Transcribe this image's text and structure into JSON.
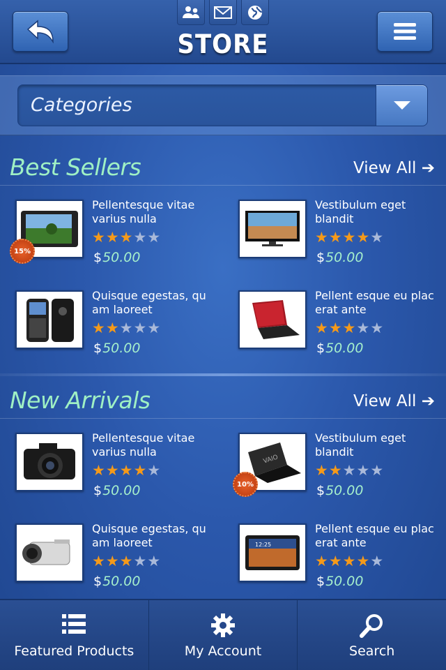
{
  "header": {
    "title": "STORE",
    "top_icons": [
      "users-icon",
      "mail-icon",
      "globe-icon"
    ],
    "back_icon": "back-arrow-icon",
    "menu_icon": "hamburger-menu-icon"
  },
  "categories": {
    "label": "Categories",
    "arrow_icon": "chevron-down-icon"
  },
  "sections": [
    {
      "title": "Best Sellers",
      "view_all": "View All ➔",
      "products": [
        {
          "name": "Pellentesque vitae varius nulla",
          "rating": 3,
          "currency": "$",
          "price": "50.00",
          "badge": "15%",
          "image": "tablet"
        },
        {
          "name": "Vestibulum eget blandit",
          "rating": 4,
          "currency": "$",
          "price": "50.00",
          "badge": "",
          "image": "monitor"
        },
        {
          "name": "Quisque egestas, qu am laoreet",
          "rating": 2,
          "currency": "$",
          "price": "50.00",
          "badge": "",
          "image": "phone"
        },
        {
          "name": "Pellent esque eu plac erat ante",
          "rating": 3,
          "currency": "$",
          "price": "50.00",
          "badge": "",
          "image": "laptop-red"
        }
      ]
    },
    {
      "title": "New Arrivals",
      "view_all": "View All ➔",
      "products": [
        {
          "name": "Pellentesque vitae varius nulla",
          "rating": 4,
          "currency": "$",
          "price": "50.00",
          "badge": "",
          "image": "camera"
        },
        {
          "name": "Vestibulum eget blandit",
          "rating": 2,
          "currency": "$",
          "price": "50.00",
          "badge": "10%",
          "image": "laptop-black"
        },
        {
          "name": "Quisque egestas, qu am laoreet",
          "rating": 3,
          "currency": "$",
          "price": "50.00",
          "badge": "",
          "image": "camcorder"
        },
        {
          "name": "Pellent esque eu plac erat ante",
          "rating": 4,
          "currency": "$",
          "price": "50.00",
          "badge": "",
          "image": "galaxy-tab"
        }
      ]
    }
  ],
  "max_rating": 5,
  "bottom_nav": [
    {
      "label": "Featured Products",
      "icon": "list-icon"
    },
    {
      "label": "My Account",
      "icon": "gear-icon"
    },
    {
      "label": "Search",
      "icon": "search-icon"
    }
  ],
  "colors": {
    "accent_green": "#9ff0c4",
    "star_on": "#f59a1a",
    "star_off": "#a9b9d9",
    "badge": "#d4471a"
  }
}
